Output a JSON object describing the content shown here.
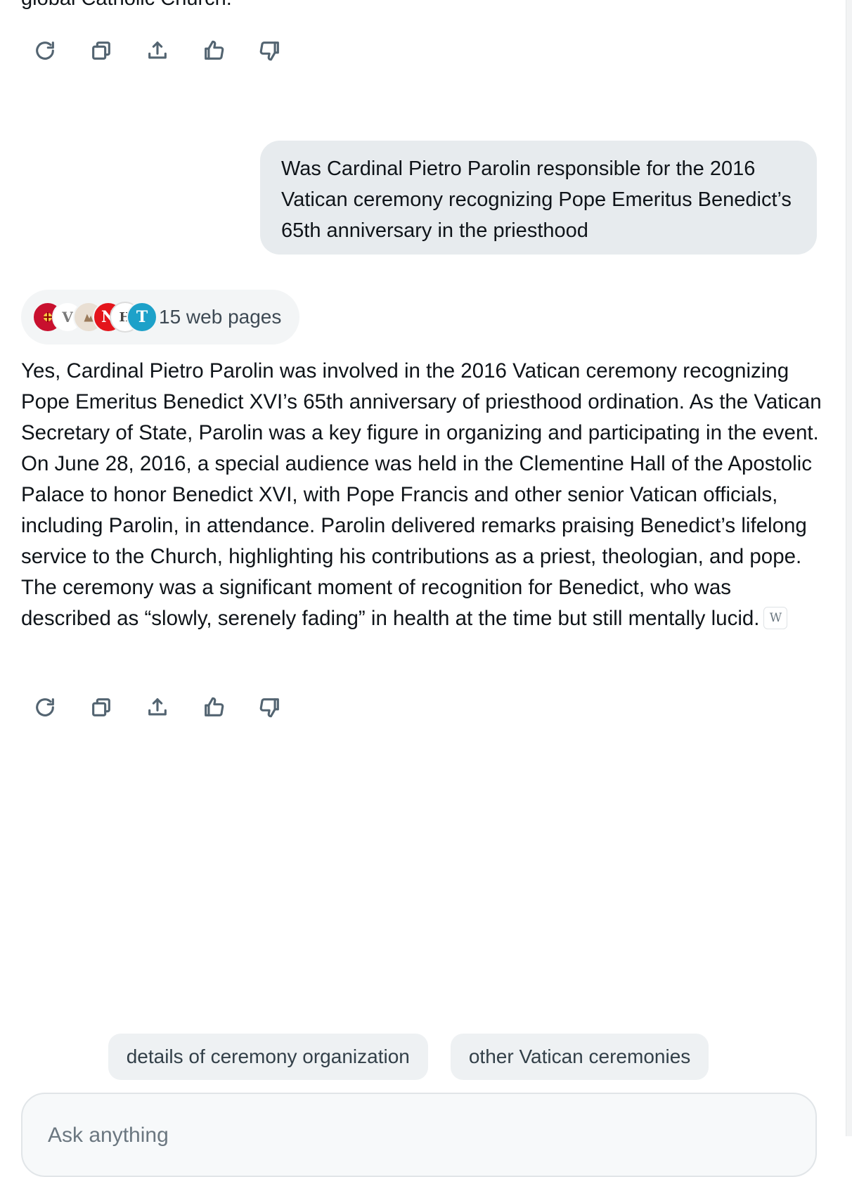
{
  "previous_answer_tail": "global Catholic Church.",
  "actions": {
    "regenerate": "regenerate-icon",
    "copy": "copy-icon",
    "share": "share-icon",
    "like": "thumbs-up-icon",
    "dislike": "thumbs-down-icon"
  },
  "user_message": "Was Cardinal Pietro Parolin responsible for the 2016 Vatican ceremony recognizing Pope Emeritus Benedict’s 65th anniversary in the priesthood",
  "sources": {
    "label": "15 web pages",
    "favicons": [
      {
        "glyph": "",
        "color": "#c8102e"
      },
      {
        "glyph": "V",
        "color": "#ffffff"
      },
      {
        "glyph": "",
        "color": "#b79a7c"
      },
      {
        "glyph": "N",
        "color": "#e4141b"
      },
      {
        "glyph": "H",
        "color": "#ffffff"
      },
      {
        "glyph": "T",
        "color": "#1da1c9"
      }
    ]
  },
  "answer": {
    "text": "Yes, Cardinal Pietro Parolin was involved in the 2016 Vatican ceremony recognizing Pope Emeritus Benedict XVI’s 65th anniversary of priesthood ordination. As the Vatican Secretary of State, Parolin was a key figure in organizing and participating in the event. On June 28, 2016, a special audience was held in the Clementine Hall of the Apostolic Palace to honor Benedict XVI, with Pope Francis and other senior Vatican officials, including Parolin, in attendance. Parolin delivered remarks praising Benedict’s lifelong service to the Church, highlighting his contributions as a priest, theologian, and pope. The ceremony was a significant moment of recognition for Benedict, who was described as “slowly, serenely fading” in health at the time but still mentally lucid.",
    "citation": "W"
  },
  "suggestions": [
    "details of ceremony organization",
    "other Vatican ceremonies"
  ],
  "composer": {
    "placeholder": "Ask anything"
  }
}
